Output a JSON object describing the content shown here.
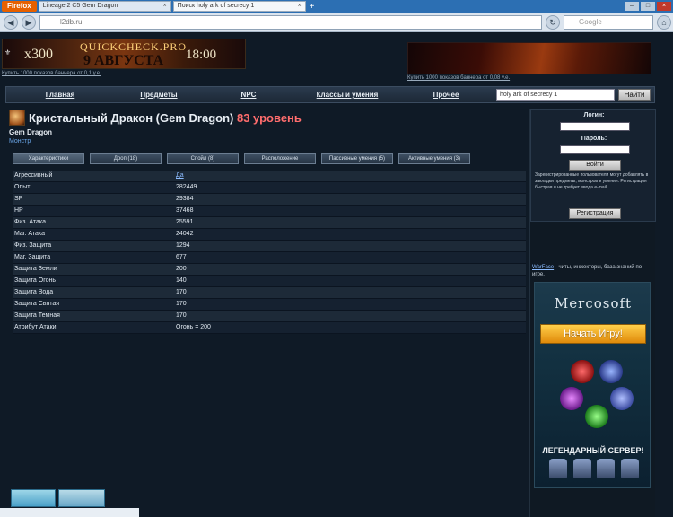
{
  "browser": {
    "app_button": "Firefox",
    "tabs": [
      {
        "label": "Lineage 2 C5 Gem Dragon",
        "active": false
      },
      {
        "label": "Поиск holy ark of secrecy 1",
        "active": true
      }
    ],
    "url": "l2db.ru",
    "search_placeholder": "Google"
  },
  "banner_left": {
    "x300": "x300",
    "qc": "QUICKCHECK.PRO",
    "date": "9 АВГУСТА",
    "time": "18:00",
    "caption": "Купить 1000 показов баннера от 0,1 у.е."
  },
  "banner_right": {
    "caption": "Купить 1000 показов баннера от 0,08 у.е."
  },
  "mainnav": {
    "items": [
      "Главная",
      "Предметы",
      "NPC",
      "Классы и умения",
      "Прочее"
    ],
    "search_value": "holy ark of secrecy 1",
    "find_button": "Найти"
  },
  "monster": {
    "name": "Кристальный Дракон (Gem Dragon)",
    "level": "83 уровень",
    "en_name": "Gem Dragon",
    "type": "Монстр"
  },
  "content_tabs": [
    {
      "label": "Характеристики",
      "active": true
    },
    {
      "label": "Дроп (18)",
      "active": false
    },
    {
      "label": "Спойл (8)",
      "active": false
    },
    {
      "label": "Расположение",
      "active": false
    },
    {
      "label": "Пассивные умения (5)",
      "active": false
    },
    {
      "label": "Активные умения (3)",
      "active": false
    }
  ],
  "stats": [
    {
      "key": "Агрессивный",
      "value": "Да",
      "link": true
    },
    {
      "key": "Опыт",
      "value": "282449",
      "link": false
    },
    {
      "key": "SP",
      "value": "29384",
      "link": false
    },
    {
      "key": "HP",
      "value": "37468",
      "link": false
    },
    {
      "key": "Физ. Атака",
      "value": "25591",
      "link": false
    },
    {
      "key": "Маг. Атака",
      "value": "24042",
      "link": false
    },
    {
      "key": "Физ. Защита",
      "value": "1294",
      "link": false
    },
    {
      "key": "Маг. Защита",
      "value": "677",
      "link": false
    },
    {
      "key": "Защита Земли",
      "value": "200",
      "link": false
    },
    {
      "key": "Защита Огонь",
      "value": "140",
      "link": false
    },
    {
      "key": "Защита Вода",
      "value": "170",
      "link": false
    },
    {
      "key": "Защита Святая",
      "value": "170",
      "link": false
    },
    {
      "key": "Защита Темная",
      "value": "170",
      "link": false
    },
    {
      "key": "Атрибут Атаки",
      "value": "Огонь = 200",
      "link": false
    }
  ],
  "login": {
    "login_label": "Логин:",
    "password_label": "Пароль:",
    "enter_button": "Войти",
    "note": "Зарегистрированные пользователи могут добавлять в закладки предметы, монстров и умения. Регистрация быстрая и не требует ввода e-mail.",
    "register_button": "Регистрация"
  },
  "warface": {
    "link": "WarFace",
    "text": " - читы, инжекторы, база знаний по игре."
  },
  "promo": {
    "brand": "Mercosoft",
    "cta": "Начать Игру!",
    "server": "ЛЕГЕНДАРНЫЙ СЕРВЕР!"
  }
}
